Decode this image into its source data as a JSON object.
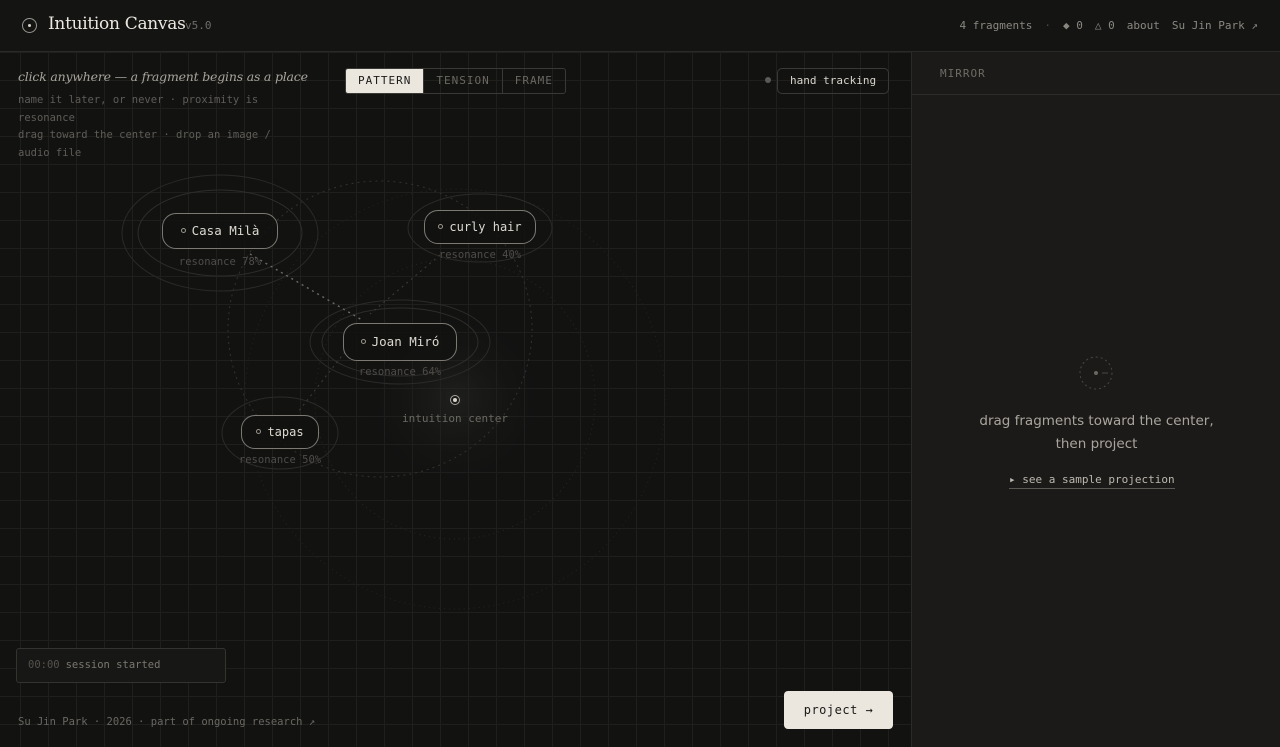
{
  "header": {
    "title": "Intuition Canvas",
    "version": "v5.0",
    "fragments_count": "4 fragments",
    "separator": "·",
    "stat_diamond": "◆ 0",
    "stat_triangle": "△ 0",
    "about_link": "about",
    "author_link": "Su Jin Park ↗"
  },
  "canvas": {
    "hint_title": "click anywhere — a fragment begins as a place",
    "hint_lines": [
      "name it later, or never · proximity is resonance",
      "drag toward the center · drop an image / audio file"
    ],
    "mode_tabs": [
      {
        "label": "PATTERN",
        "active": true
      },
      {
        "label": "TENSION",
        "active": false
      },
      {
        "label": "FRAME",
        "active": false
      }
    ],
    "hand_tracking_label": "hand tracking",
    "fragments": [
      {
        "label": "Casa Milà",
        "resonance": "resonance 78%"
      },
      {
        "label": "curly hair",
        "resonance": "resonance 40%"
      },
      {
        "label": "Joan Miró",
        "resonance": "resonance 64%"
      },
      {
        "label": "tapas",
        "resonance": "resonance 50%"
      }
    ],
    "center_label": "intuition center",
    "session": {
      "time": "00:00",
      "text": "session started"
    },
    "footer_credit": "Su Jin Park · 2026 · part of ongoing research ↗",
    "project_button": "project →"
  },
  "mirror": {
    "title": "MIRROR",
    "message_line1": "drag fragments toward the center,",
    "message_line2": "then project",
    "sample_link": "▸ see a sample projection"
  },
  "colors": {
    "background": "#121211",
    "panel": "#1b1a18",
    "accent_light": "#ebe7df",
    "text": "#d8d4cc"
  }
}
